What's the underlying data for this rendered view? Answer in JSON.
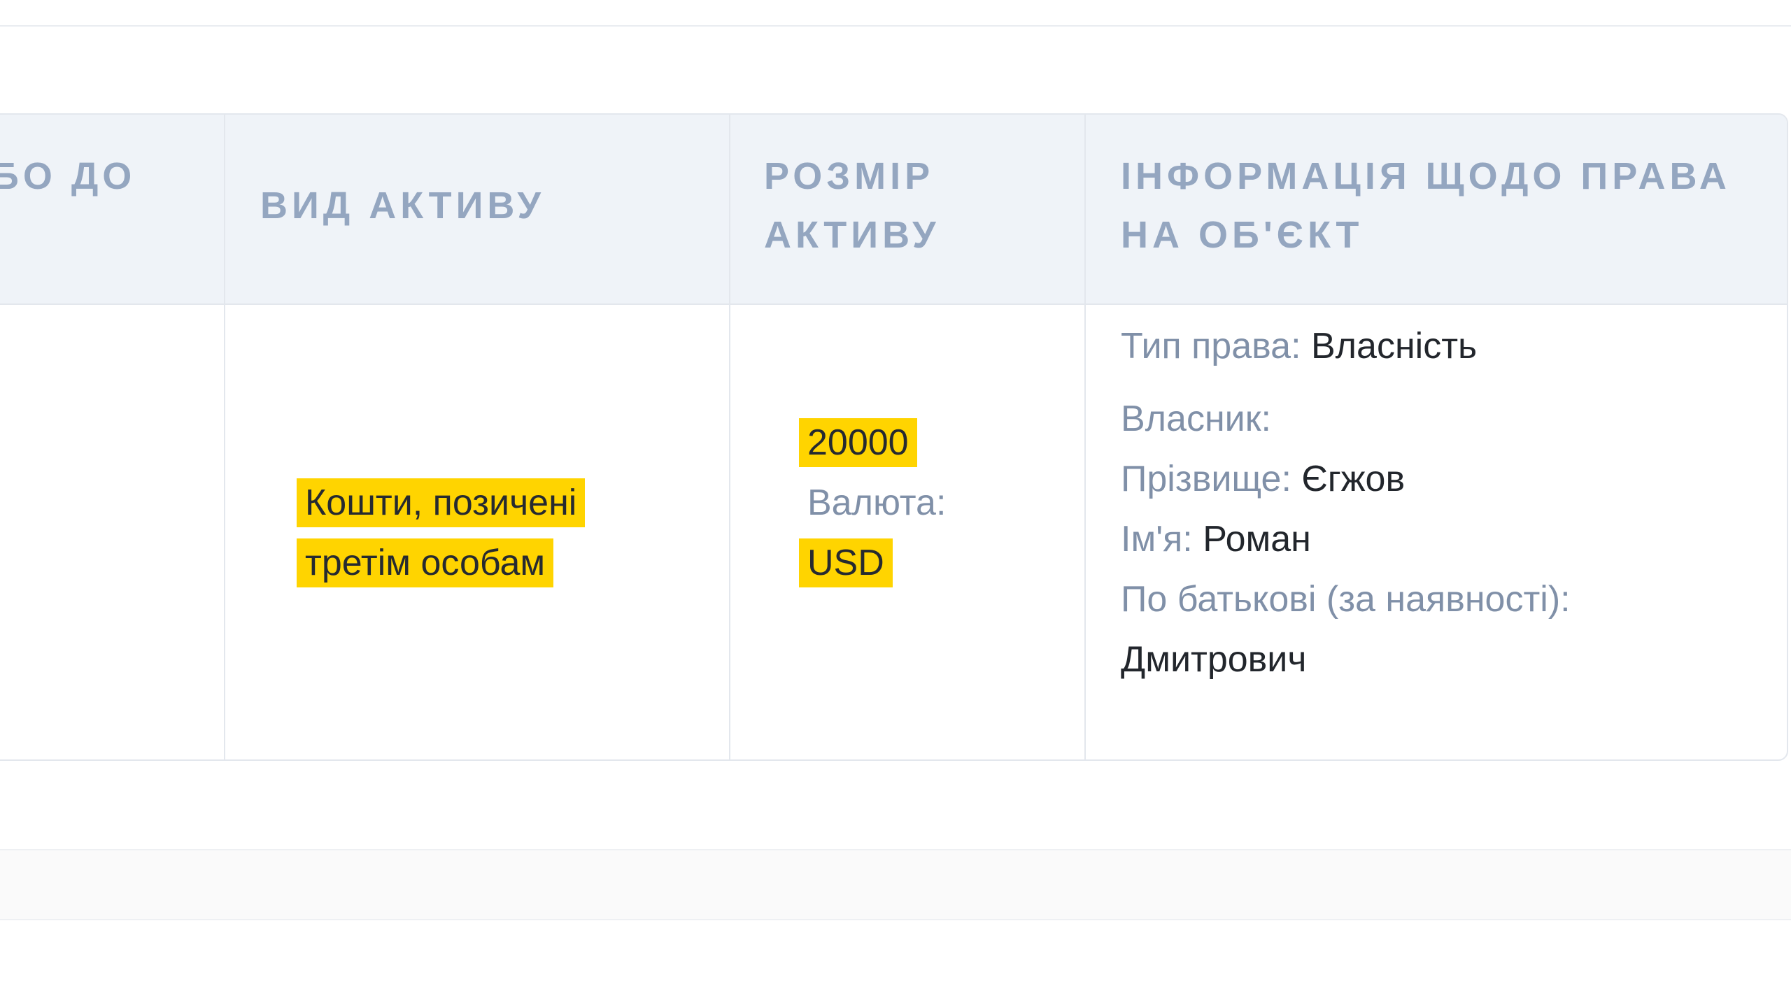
{
  "table": {
    "headers": {
      "col1_partial": "БО ДО",
      "asset_type": "ВИД АКТИВУ",
      "asset_size_line1": "РОЗМІР",
      "asset_size_line2": "АКТИВУ",
      "ownership_info_line1": "ІНФОРМАЦІЯ ЩОДО ПРАВА",
      "ownership_info_line2": "НА ОБ'ЄКТ"
    },
    "row": {
      "asset_type_line1": "Кошти, позичені",
      "asset_type_line2": "третім особам",
      "amount": "20000",
      "currency_label": "Валюта:",
      "currency": "USD",
      "right_type_label": "Тип права:",
      "right_type_value": "Власність",
      "owner_label": "Власник:",
      "surname_label": "Прізвище:",
      "surname_value": "Єгжов",
      "name_label": "Ім'я:",
      "name_value": "Роман",
      "patronymic_label": "По батькові (за наявності):",
      "patronymic_value": "Дмитрович"
    }
  },
  "colors": {
    "highlight": "#ffd400",
    "header_bg": "#eff3f8",
    "header_text": "#94a6c0",
    "label_text": "#8090a8"
  }
}
